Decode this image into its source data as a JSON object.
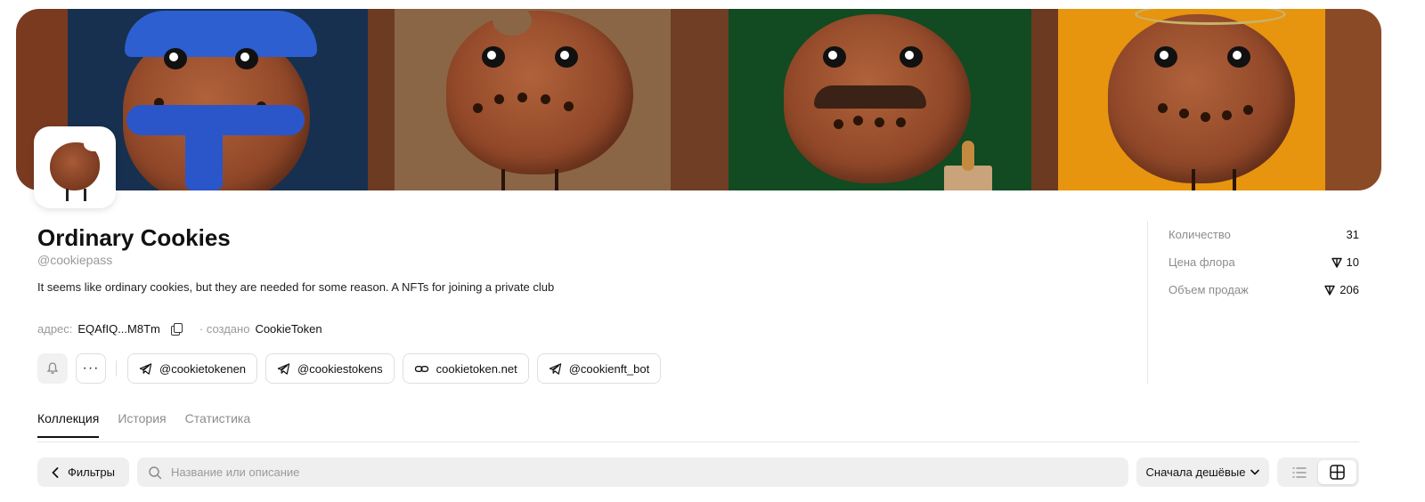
{
  "collection": {
    "name": "Ordinary Cookies",
    "handle": "@cookiepass",
    "description": "It seems like ordinary cookies, but they are needed for some reason. A NFTs for joining a private club",
    "address_label": "адрес:",
    "address": "EQAfIQ...M8Tm",
    "created_label": "· создано",
    "creator": "CookieToken"
  },
  "links": [
    {
      "label": "@cookietokenen",
      "icon": "telegram-icon"
    },
    {
      "label": "@cookiestokens",
      "icon": "telegram-icon"
    },
    {
      "label": "cookietoken.net",
      "icon": "link-icon"
    },
    {
      "label": "@cookienft_bot",
      "icon": "telegram-icon"
    }
  ],
  "more_label": "···",
  "stats": [
    {
      "label": "Количество",
      "value": "31",
      "currency_icon": false
    },
    {
      "label": "Цена флора",
      "value": "10",
      "currency_icon": true
    },
    {
      "label": "Объем продаж",
      "value": "206",
      "currency_icon": true
    }
  ],
  "tabs": [
    {
      "label": "Коллекция",
      "active": true
    },
    {
      "label": "История",
      "active": false
    },
    {
      "label": "Статистика",
      "active": false
    }
  ],
  "toolbar": {
    "filters_label": "Фильтры",
    "search_placeholder": "Название или описание",
    "sort_label": "Сначала дешёвые"
  },
  "colors": {
    "text_primary": "#111111",
    "text_muted": "#8c8c8c",
    "control_bg": "#efefef",
    "border": "#dedede"
  }
}
